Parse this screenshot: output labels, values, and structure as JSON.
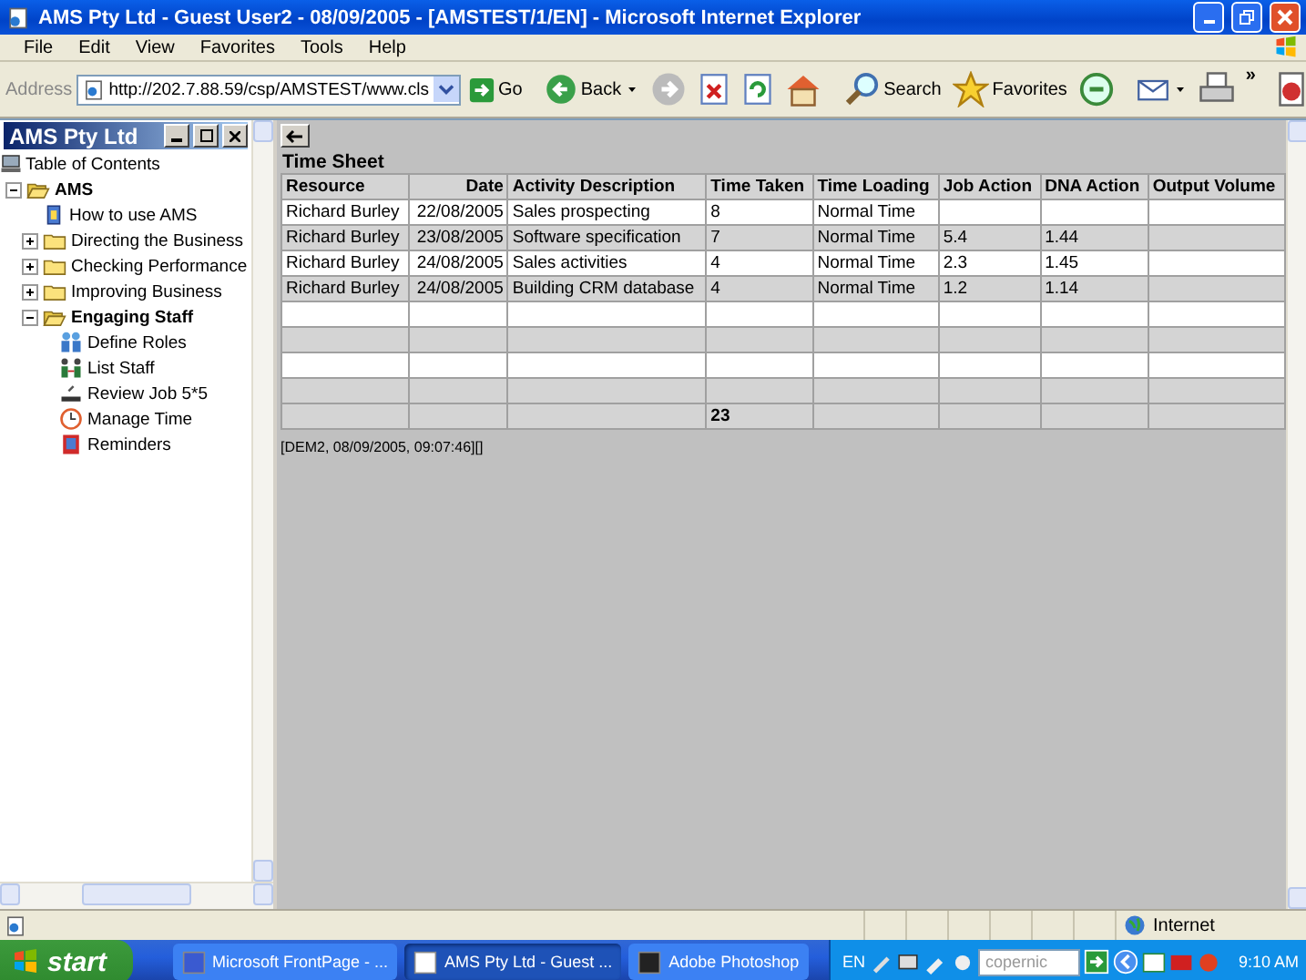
{
  "window": {
    "title": "AMS Pty Ltd - Guest User2 - 08/09/2005 - [AMSTEST/1/EN] - Microsoft Internet Explorer"
  },
  "menu": [
    "File",
    "Edit",
    "View",
    "Favorites",
    "Tools",
    "Help"
  ],
  "toolbar": {
    "address_label": "Address",
    "address": "http://202.7.88.59/csp/AMSTEST/www.cls",
    "go": "Go",
    "back": "Back",
    "search": "Search",
    "favorites": "Favorites",
    "more": "»"
  },
  "sidebar": {
    "title": "AMS Pty Ltd",
    "contents_label": "Table of Contents",
    "tree": [
      {
        "label": "AMS",
        "kind": "folder",
        "expanded": true,
        "children": [
          {
            "label": "How to use AMS",
            "kind": "help"
          },
          {
            "label": "Directing the Business",
            "kind": "folder",
            "expanded": false
          },
          {
            "label": "Checking Performance",
            "kind": "folder",
            "expanded": false
          },
          {
            "label": "Improving Business",
            "kind": "folder",
            "expanded": false
          },
          {
            "label": "Engaging Staff",
            "kind": "folder",
            "expanded": true,
            "children": [
              {
                "label": "Define Roles",
                "kind": "roles"
              },
              {
                "label": "List Staff",
                "kind": "staff"
              },
              {
                "label": "Review Job 5*5",
                "kind": "review"
              },
              {
                "label": "Manage Time",
                "kind": "clock"
              },
              {
                "label": "Reminders",
                "kind": "reminder"
              }
            ]
          }
        ]
      }
    ]
  },
  "main": {
    "title": "Time Sheet",
    "table": {
      "columns": [
        "Resource",
        "Date",
        "Activity Description",
        "Time Taken",
        "Time Loading",
        "Job Action",
        "DNA Action",
        "Output Volume"
      ],
      "rows": [
        [
          "Richard Burley",
          "22/08/2005",
          "Sales prospecting",
          "8",
          "Normal Time",
          "",
          "",
          ""
        ],
        [
          "Richard Burley",
          "23/08/2005",
          "Software specification",
          "7",
          "Normal Time",
          "5.4",
          "1.44",
          ""
        ],
        [
          "Richard Burley",
          "24/08/2005",
          "Sales activities",
          "4",
          "Normal Time",
          "2.3",
          "1.45",
          ""
        ],
        [
          "Richard Burley",
          "24/08/2005",
          "Building CRM database",
          "4",
          "Normal Time",
          "1.2",
          "1.14",
          ""
        ]
      ],
      "total": "23"
    },
    "footer": "[DEM2, 08/09/2005, 09:07:46][]"
  },
  "status_bar": {
    "zone": "Internet"
  },
  "taskbar": {
    "start": "start",
    "tasks": [
      {
        "label": "Microsoft FrontPage - ...",
        "selected": false
      },
      {
        "label": "AMS Pty Ltd - Guest ...",
        "selected": true
      },
      {
        "label": "Adobe Photoshop",
        "selected": false
      }
    ],
    "language": "EN",
    "search_placeholder": "copernic",
    "clock": "9:10 AM"
  }
}
